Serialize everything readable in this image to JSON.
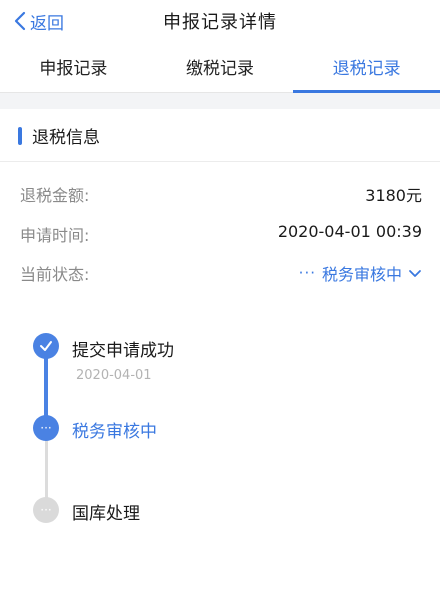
{
  "nav": {
    "back_label": "返回",
    "title": "申报记录详情"
  },
  "tabs": [
    {
      "label": "申报记录",
      "active": false
    },
    {
      "label": "缴税记录",
      "active": false
    },
    {
      "label": "退税记录",
      "active": true
    }
  ],
  "section": {
    "title": "退税信息"
  },
  "info": {
    "amount_label": "退税金额:",
    "amount_value": "3180元",
    "time_label": "申请时间:",
    "time_value": "2020-04-01 00:39",
    "status_label": "当前状态:",
    "status_value": "税务审核中"
  },
  "timeline": [
    {
      "title": "提交申请成功",
      "date": "2020-04-01",
      "state": "done"
    },
    {
      "title": "税务审核中",
      "date": "",
      "state": "current"
    },
    {
      "title": "国库处理",
      "date": "",
      "state": "pending"
    }
  ],
  "colors": {
    "accent": "#3a78e0",
    "node_active": "#4a82e3",
    "node_pending": "#dadada",
    "label_gray": "#8a8a8a",
    "section_bg": "#f3f4f6"
  },
  "icons": {
    "back": "chevron-left-icon",
    "status_more": "ellipsis-icon",
    "status_expand": "chevron-down-icon",
    "step_done": "check-icon",
    "step_pending": "ellipsis-icon"
  }
}
